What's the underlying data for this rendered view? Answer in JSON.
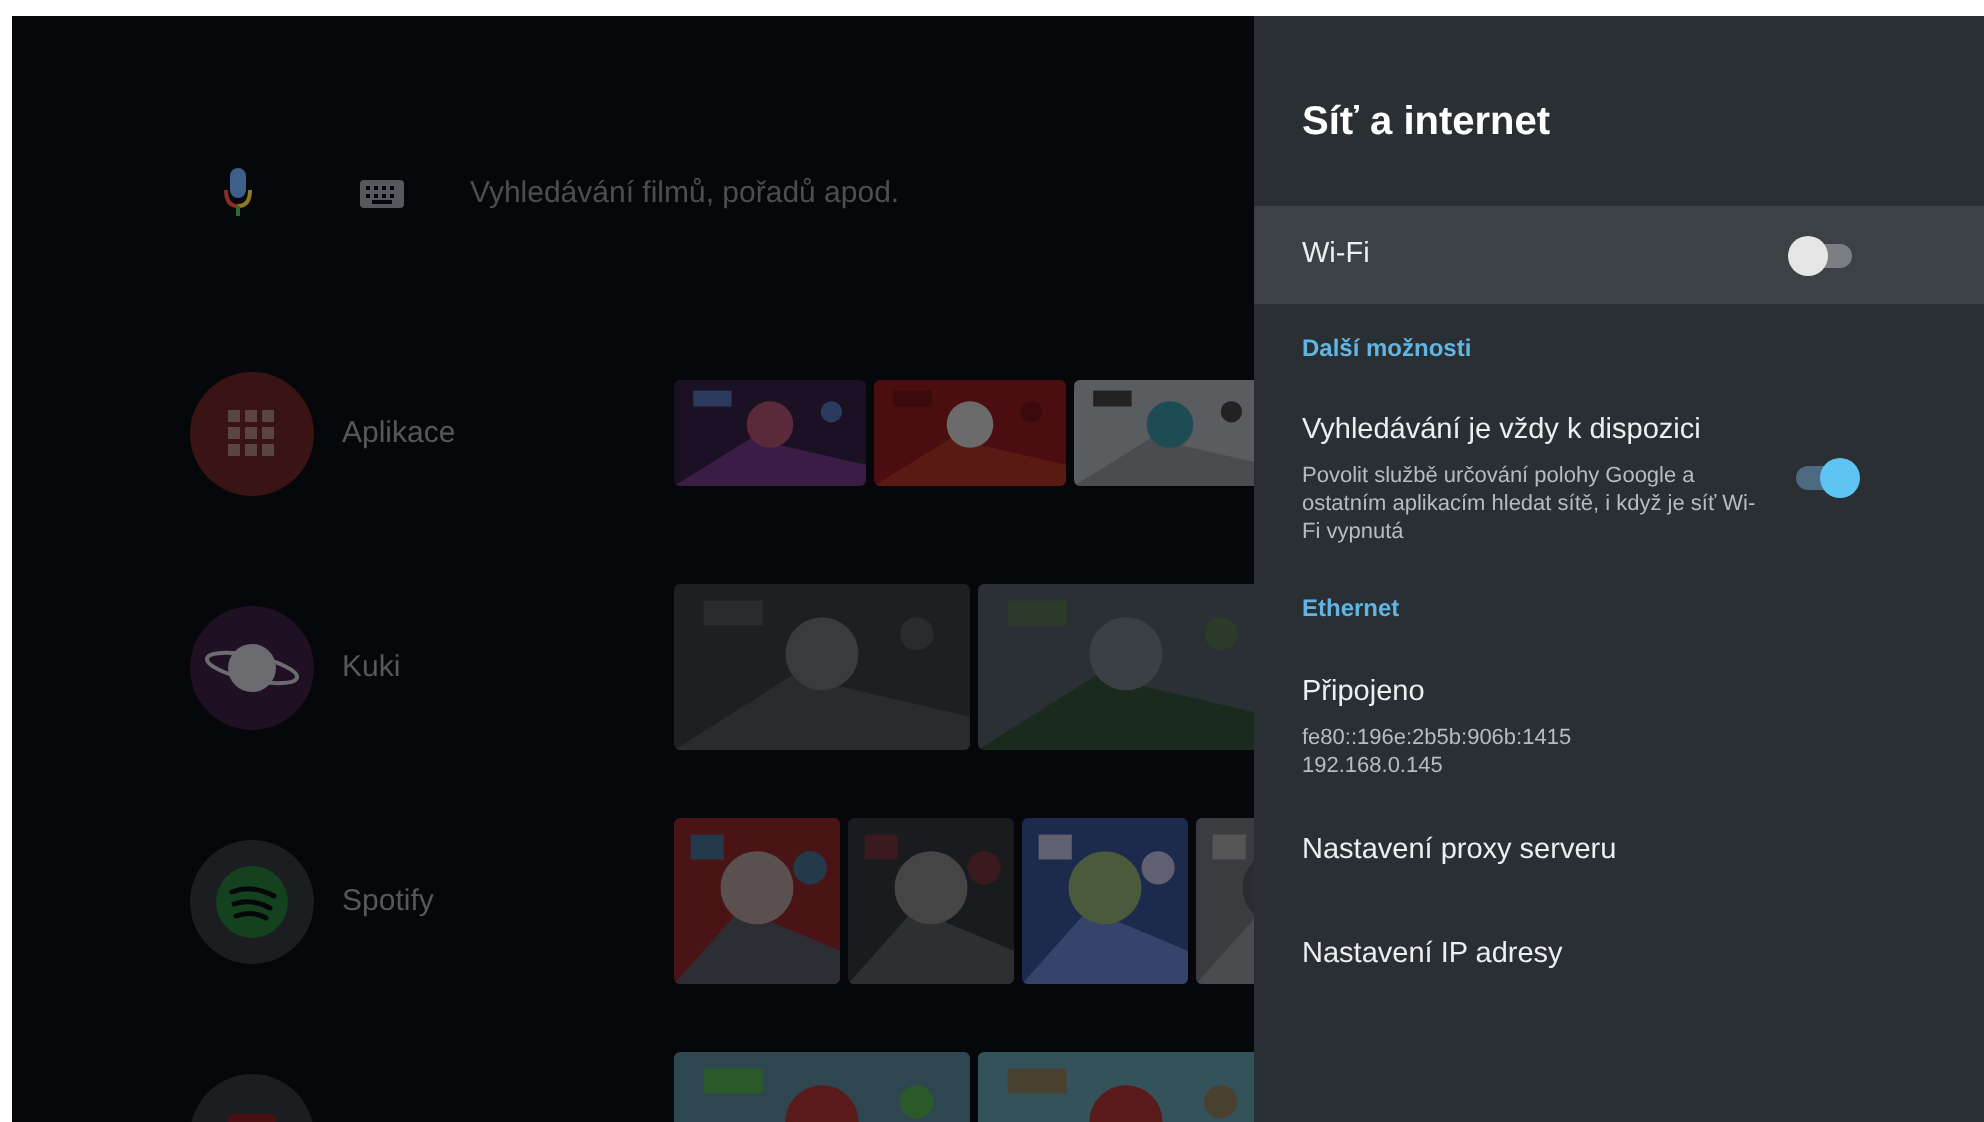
{
  "search": {
    "placeholder": "Vyhledávání filmů, pořadů apod."
  },
  "rows": [
    {
      "kind": "apps",
      "label": "Aplikace"
    },
    {
      "kind": "kuki",
      "label": "Kuki"
    },
    {
      "kind": "spotify",
      "label": "Spotify"
    },
    {
      "kind": "red-app"
    }
  ],
  "settings": {
    "title": "Síť a internet",
    "items": [
      {
        "kind": "toggle",
        "label": "Wi-Fi",
        "on": false,
        "selected": true
      },
      {
        "kind": "section",
        "label": "Další možnosti"
      },
      {
        "kind": "toggle",
        "label": "Vyhledávání je vždy k dispozici",
        "summary": "Povolit službě určování polohy Google a ostatním aplikacím hledat sítě, i když je síť Wi-Fi vypnutá",
        "on": true,
        "selected": false
      },
      {
        "kind": "section",
        "label": "Ethernet"
      },
      {
        "kind": "info",
        "label": "Připojeno",
        "details": [
          "fe80::196e:2b5b:906b:1415",
          "192.168.0.145"
        ],
        "selected": false
      },
      {
        "kind": "link",
        "label": "Nastavení proxy serveru",
        "selected": false
      },
      {
        "kind": "link",
        "label": "Nastavení IP adresy",
        "selected": false
      }
    ]
  }
}
